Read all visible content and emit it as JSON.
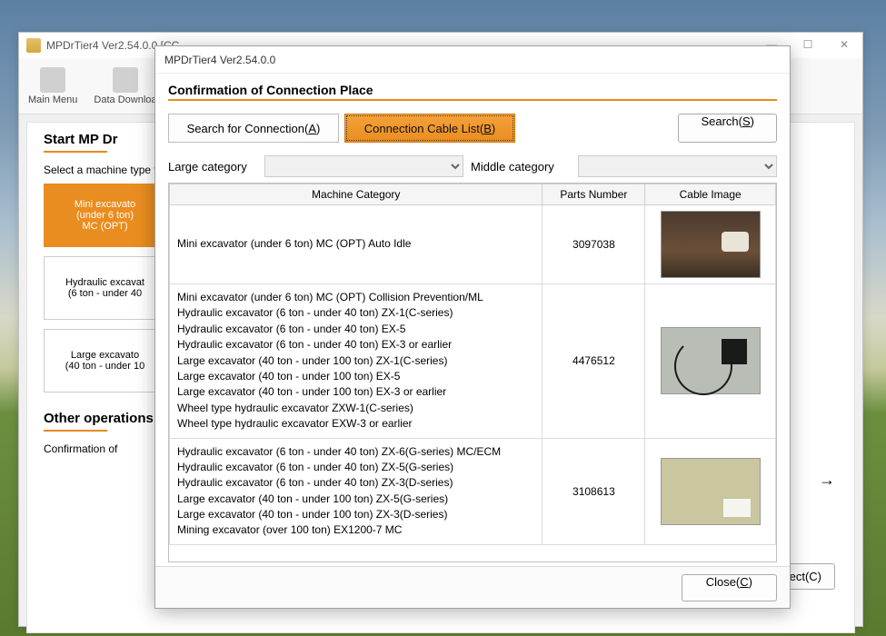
{
  "main_window": {
    "title": "MPDrTier4 Ver2.54.0.0 [CC",
    "toolbar": {
      "main_menu": "Main Menu",
      "data_download": "Data Downloa"
    },
    "start_heading": "Start MP Dr",
    "select_prompt": "Select a machine type to v",
    "machine_cards": [
      "Mini excavato\n(under 6 ton)\nMC (OPT)",
      "Hydraulic excavat\n(6 ton - under 40",
      "Large excavato\n(40 ton - under 10"
    ],
    "other_ops": "Other operations",
    "confirmation_of": "Confirmation of",
    "connect_btn": "nect(C)"
  },
  "dialog": {
    "title": "MPDrTier4 Ver2.54.0.0",
    "heading": "Confirmation of Connection Place",
    "tabs": {
      "search": "Search for Connection(A)",
      "cable_list": "Connection Cable List(B)"
    },
    "search_btn": "Search(S)",
    "filters": {
      "large_label": "Large category",
      "middle_label": "Middle category"
    },
    "table": {
      "columns": [
        "Machine Category",
        "Parts Number",
        "Cable Image"
      ],
      "rows": [
        {
          "categories": [
            "Mini excavator (under 6 ton) MC (OPT) Auto Idle"
          ],
          "parts_number": "3097038",
          "thumb": "thumb1"
        },
        {
          "categories": [
            "Mini excavator (under 6 ton) MC (OPT) Collision Prevention/ML",
            "Hydraulic excavator (6 ton - under 40 ton) ZX-1(C-series)",
            "Hydraulic excavator (6 ton - under 40 ton) EX-5",
            "Hydraulic excavator (6 ton - under 40 ton) EX-3 or earlier",
            "Large excavator (40 ton - under 100 ton) ZX-1(C-series)",
            "Large excavator (40 ton - under 100 ton) EX-5",
            "Large excavator (40 ton - under 100 ton) EX-3 or earlier",
            "Wheel type hydraulic excavator ZXW-1(C-series)",
            "Wheel type hydraulic excavator EXW-3 or earlier"
          ],
          "parts_number": "4476512",
          "thumb": "thumb2"
        },
        {
          "categories": [
            "Hydraulic excavator (6 ton - under 40 ton) ZX-6(G-series) MC/ECM",
            "Hydraulic excavator (6 ton - under 40 ton) ZX-5(G-series)",
            "Hydraulic excavator (6 ton - under 40 ton) ZX-3(D-series)",
            "Large excavator (40 ton - under 100 ton) ZX-5(G-series)",
            "Large excavator (40 ton - under 100 ton) ZX-3(D-series)",
            "Mining excavator (over 100 ton) EX1200-7 MC"
          ],
          "parts_number": "3108613",
          "thumb": "thumb3"
        }
      ]
    },
    "close_btn": "Close(C)"
  }
}
